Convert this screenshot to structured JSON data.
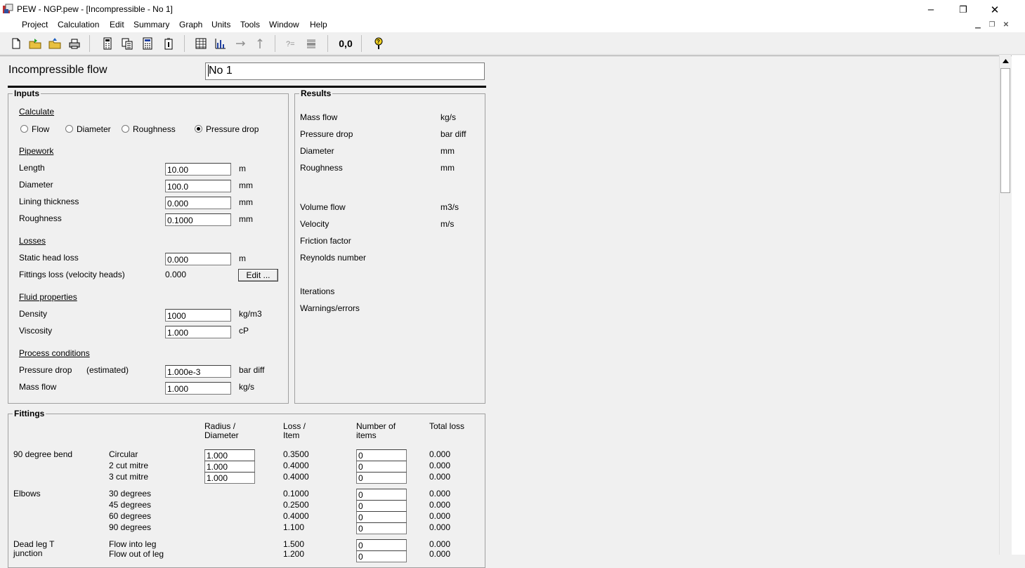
{
  "window": {
    "title": "PEW - NGP.pew - [Incompressible - No  1]",
    "minimize": "–",
    "restore": "❐",
    "close": "✕"
  },
  "menu": [
    "Project",
    "Calculation",
    "Edit",
    "Summary",
    "Graph",
    "Units",
    "Tools",
    "Window",
    "Help"
  ],
  "toolbar": {
    "xy_label": "0,0"
  },
  "doc": {
    "heading": "Incompressible flow",
    "name_value": "No  1"
  },
  "inputs": {
    "title": "Inputs",
    "calculate": {
      "title": "Calculate",
      "options": [
        "Flow",
        "Diameter",
        "Roughness",
        "Pressure drop"
      ],
      "selected": "Pressure drop"
    },
    "pipework": {
      "title": "Pipework",
      "rows": [
        {
          "label": "Length",
          "value": "10.00",
          "unit": "m"
        },
        {
          "label": "Diameter",
          "value": "100.0",
          "unit": "mm"
        },
        {
          "label": "Lining thickness",
          "value": "0.000",
          "unit": "mm"
        },
        {
          "label": "Roughness",
          "value": "0.1000",
          "unit": "mm"
        }
      ]
    },
    "losses": {
      "title": "Losses",
      "static_label": "Static head loss",
      "static_value": "0.000",
      "static_unit": "m",
      "fittings_label": "Fittings loss (velocity heads)",
      "fittings_value": "0.000",
      "edit_button": "Edit ..."
    },
    "fluid": {
      "title": "Fluid properties",
      "rows": [
        {
          "label": "Density",
          "value": "1000",
          "unit": "kg/m3"
        },
        {
          "label": "Viscosity",
          "value": "1.000",
          "unit": "cP"
        }
      ]
    },
    "process": {
      "title": "Process conditions",
      "pressure_label": "Pressure drop",
      "pressure_note": "(estimated)",
      "pressure_value": "1.000e-3",
      "pressure_unit": "bar diff",
      "mass_label": "Mass flow",
      "mass_value": "1.000",
      "mass_unit": "kg/s"
    }
  },
  "results": {
    "title": "Results",
    "rows": [
      {
        "label": "Mass flow",
        "unit": "kg/s"
      },
      {
        "label": "Pressure drop",
        "unit": "bar diff"
      },
      {
        "label": "Diameter",
        "unit": "mm"
      },
      {
        "label": "Roughness",
        "unit": "mm"
      },
      {
        "label": "Volume flow",
        "unit": "m3/s"
      },
      {
        "label": "Velocity",
        "unit": "m/s"
      },
      {
        "label": "Friction factor",
        "unit": ""
      },
      {
        "label": "Reynolds number",
        "unit": ""
      },
      {
        "label": "Iterations",
        "unit": ""
      },
      {
        "label": "Warnings/errors",
        "unit": ""
      }
    ]
  },
  "fittings": {
    "title": "Fittings",
    "headers": {
      "radius_1": "Radius /",
      "radius_2": "Diameter",
      "loss_1": "Loss /",
      "loss_2": "Item",
      "num_1": "Number of",
      "num_2": "items",
      "total": "Total loss"
    },
    "groups": {
      "bend": "90 degree bend",
      "elbows": "Elbows",
      "deadleg_1": "Dead leg T",
      "deadleg_2": "junction"
    },
    "rows": [
      {
        "type": "Circular",
        "radius": "1.000",
        "loss": "0.3500",
        "count": "0",
        "total": "0.000"
      },
      {
        "type": "2 cut mitre",
        "radius": "1.000",
        "loss": "0.4000",
        "count": "0",
        "total": "0.000"
      },
      {
        "type": "3 cut mitre",
        "radius": "1.000",
        "loss": "0.4000",
        "count": "0",
        "total": "0.000"
      },
      {
        "type": "30 degrees",
        "radius": "",
        "loss": "0.1000",
        "count": "0",
        "total": "0.000"
      },
      {
        "type": "45 degrees",
        "radius": "",
        "loss": "0.2500",
        "count": "0",
        "total": "0.000"
      },
      {
        "type": "60 degrees",
        "radius": "",
        "loss": "0.4000",
        "count": "0",
        "total": "0.000"
      },
      {
        "type": "90 degrees",
        "radius": "",
        "loss": "1.100",
        "count": "0",
        "total": "0.000"
      },
      {
        "type": "Flow into leg",
        "radius": "",
        "loss": "1.500",
        "count": "0",
        "total": "0.000"
      },
      {
        "type": "Flow out of leg",
        "radius": "",
        "loss": "1.200",
        "count": "0",
        "total": "0.000"
      }
    ]
  }
}
